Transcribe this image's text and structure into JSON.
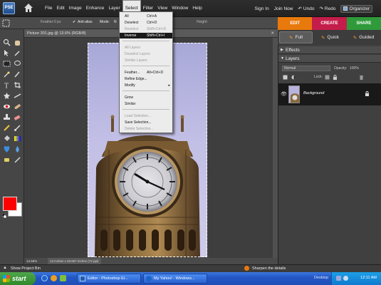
{
  "app": {
    "logo_text": "PSE"
  },
  "menubar": {
    "items": [
      "File",
      "Edit",
      "Image",
      "Enhance",
      "Layer",
      "Select",
      "Filter",
      "View",
      "Window",
      "Help"
    ],
    "active": "Select",
    "right": {
      "sign_in": "Sign In",
      "join_now": "Join Now",
      "undo": "Undo",
      "redo": "Redo",
      "organizer": "Organizer"
    }
  },
  "options_bar": {
    "feather": "Feather:",
    "feather_value": "0 px",
    "anti_alias": "Anti-alias",
    "mode": "Mode:",
    "mode_value": "N",
    "height": "Height:"
  },
  "mode_tabs": {
    "edit": "EDIT",
    "create": "CREATE",
    "share": "SHARE",
    "colors": {
      "edit": "#e8790d",
      "create": "#c41d4b",
      "share": "#2f9a3a"
    }
  },
  "sub_tabs": {
    "full": "Full",
    "quick": "Quick",
    "guided": "Guided"
  },
  "document": {
    "title": "Picture 301.jpg @ 13.6% (RGB/8)",
    "zoom": "13.59%",
    "size": "13 inches x 33.667 inches (72 ppi)"
  },
  "select_menu": {
    "items": [
      {
        "label": "All",
        "shortcut": "Ctrl+A",
        "state": "normal"
      },
      {
        "label": "Deselect",
        "shortcut": "Ctrl+D",
        "state": "normal"
      },
      {
        "label": "Reselect",
        "shortcut": "Shift+Ctrl+D",
        "state": "disabled"
      },
      {
        "label": "Inverse",
        "shortcut": "Shift+Ctrl+I",
        "state": "highlighted"
      },
      {
        "label": "All Layers",
        "shortcut": "",
        "state": "disabled"
      },
      {
        "label": "Deselect Layers",
        "shortcut": "",
        "state": "disabled"
      },
      {
        "label": "Similar Layers",
        "shortcut": "",
        "state": "disabled"
      },
      {
        "label": "Feather...",
        "shortcut": "Alt+Ctrl+D",
        "state": "normal"
      },
      {
        "label": "Refine Edge...",
        "shortcut": "",
        "state": "normal"
      },
      {
        "label": "Modify",
        "shortcut": "",
        "state": "normal",
        "submenu": "▸"
      },
      {
        "label": "Grow",
        "shortcut": "",
        "state": "normal"
      },
      {
        "label": "Similar",
        "shortcut": "",
        "state": "normal"
      },
      {
        "label": "Load Selection...",
        "shortcut": "",
        "state": "disabled"
      },
      {
        "label": "Save Selection...",
        "shortcut": "",
        "state": "normal"
      },
      {
        "label": "Delete Selection...",
        "shortcut": "",
        "state": "disabled"
      }
    ]
  },
  "panels": {
    "effects": "Effects",
    "layers": "Layers",
    "blend_mode": "Normal",
    "opacity_label": "Opacity:",
    "opacity_value": "100%",
    "lock_label": "Lock:",
    "layer_name": "Background"
  },
  "project_bin": {
    "label": "Show Project Bin",
    "tip": "Sharpen the details"
  },
  "taskbar": {
    "start": "start",
    "tasks": [
      "Editor - Photoshop El...",
      "My Yahoo! - Windows..."
    ],
    "desktop": "Desktop",
    "clock": "12:11 AM"
  },
  "colors": {
    "foreground": "#ff0000",
    "background": "#ffffff",
    "highlight": "#1a1a1a"
  }
}
